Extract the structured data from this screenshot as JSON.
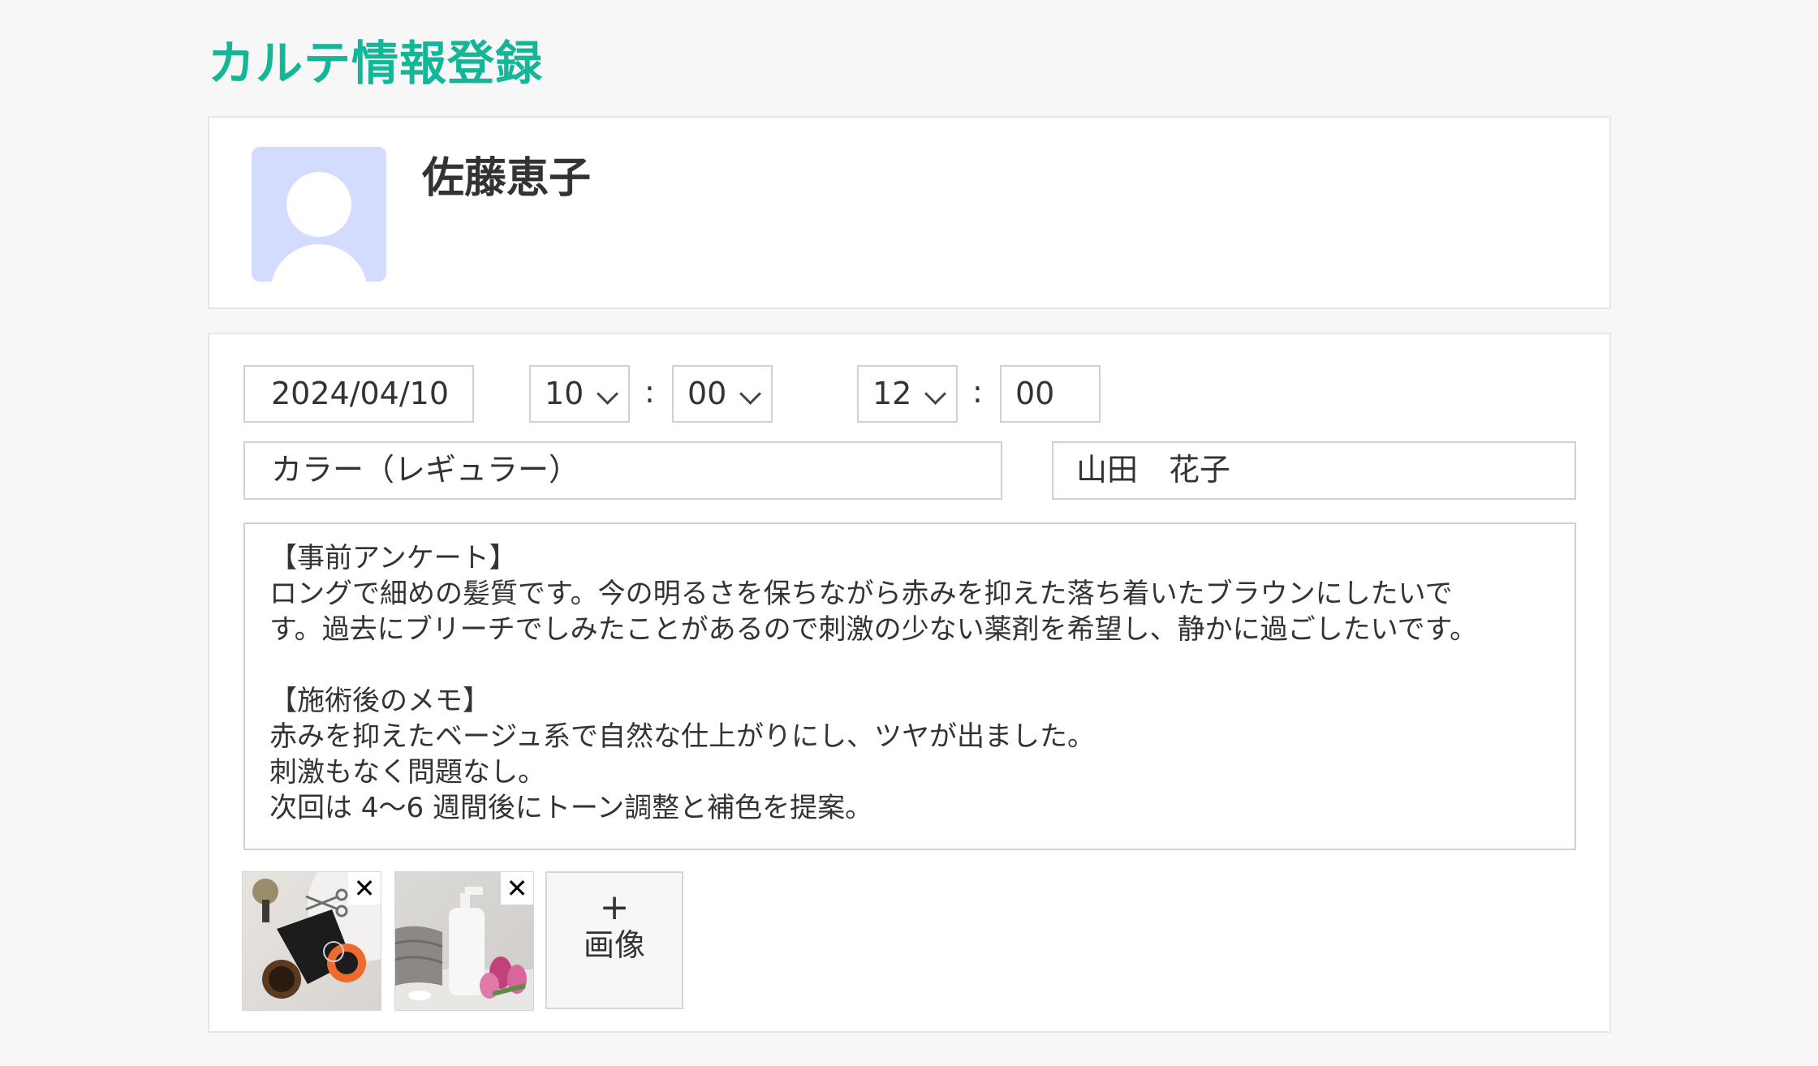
{
  "page": {
    "title": "カルテ情報登録"
  },
  "customer": {
    "name": "佐藤恵子",
    "avatar_icon": "user-avatar-icon"
  },
  "form": {
    "date": "2024/04/10",
    "start_hour": "10",
    "start_minute": "00",
    "end_hour": "12",
    "end_minute": "00",
    "time_separator": ":",
    "menu": "カラー（レギュラー）",
    "staff": "山田　花子",
    "memo_lines": [
      "【事前アンケート】",
      "ロングで細めの髪質です。今の明るさを保ちながら赤みを抑えた落ち着いたブラウンにしたいで",
      "す。過去にブリーチでしみたことがあるので刺激の少ない薬剤を希望し、静かに過ごしたいです。",
      "",
      "【施術後のメモ】",
      "赤みを抑えたベージュ系で自然な仕上がりにし、ツヤが出ました。",
      "刺激もなく問題なし。",
      "次回は 4〜6 週間後にトーン調整と補色を提案。"
    ]
  },
  "images": {
    "remove_label": "✕",
    "add_plus": "+",
    "add_label": "画像"
  },
  "colors": {
    "accent": "#13b697",
    "avatar_bg": "#d3dcff"
  }
}
